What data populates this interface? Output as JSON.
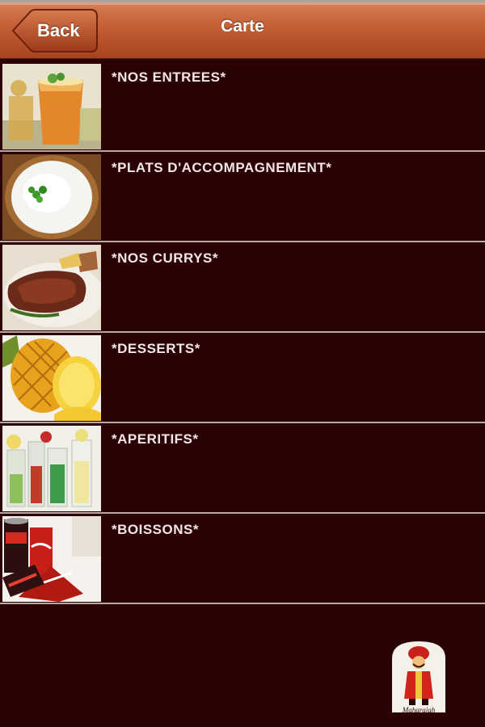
{
  "header": {
    "back_label": "Back",
    "title": "Carte"
  },
  "categories": [
    {
      "label": "*NOS ENTREES*",
      "thumb": "starter-drink-image"
    },
    {
      "label": "*PLATS D'ACCOMPAGNEMENT*",
      "thumb": "rice-bowl-image"
    },
    {
      "label": "*NOS CURRYS*",
      "thumb": "curry-meat-image"
    },
    {
      "label": "*DESSERTS*",
      "thumb": "pineapple-image"
    },
    {
      "label": "*APERITIFS*",
      "thumb": "cocktails-image"
    },
    {
      "label": "*BOISSONS*",
      "thumb": "soda-cans-image"
    }
  ],
  "logo": {
    "text": "Maharajah"
  },
  "colors": {
    "background": "#2a0204",
    "navbar": "#c45e35",
    "separator": "#b9a7a3",
    "label": "#f2e6e6"
  }
}
